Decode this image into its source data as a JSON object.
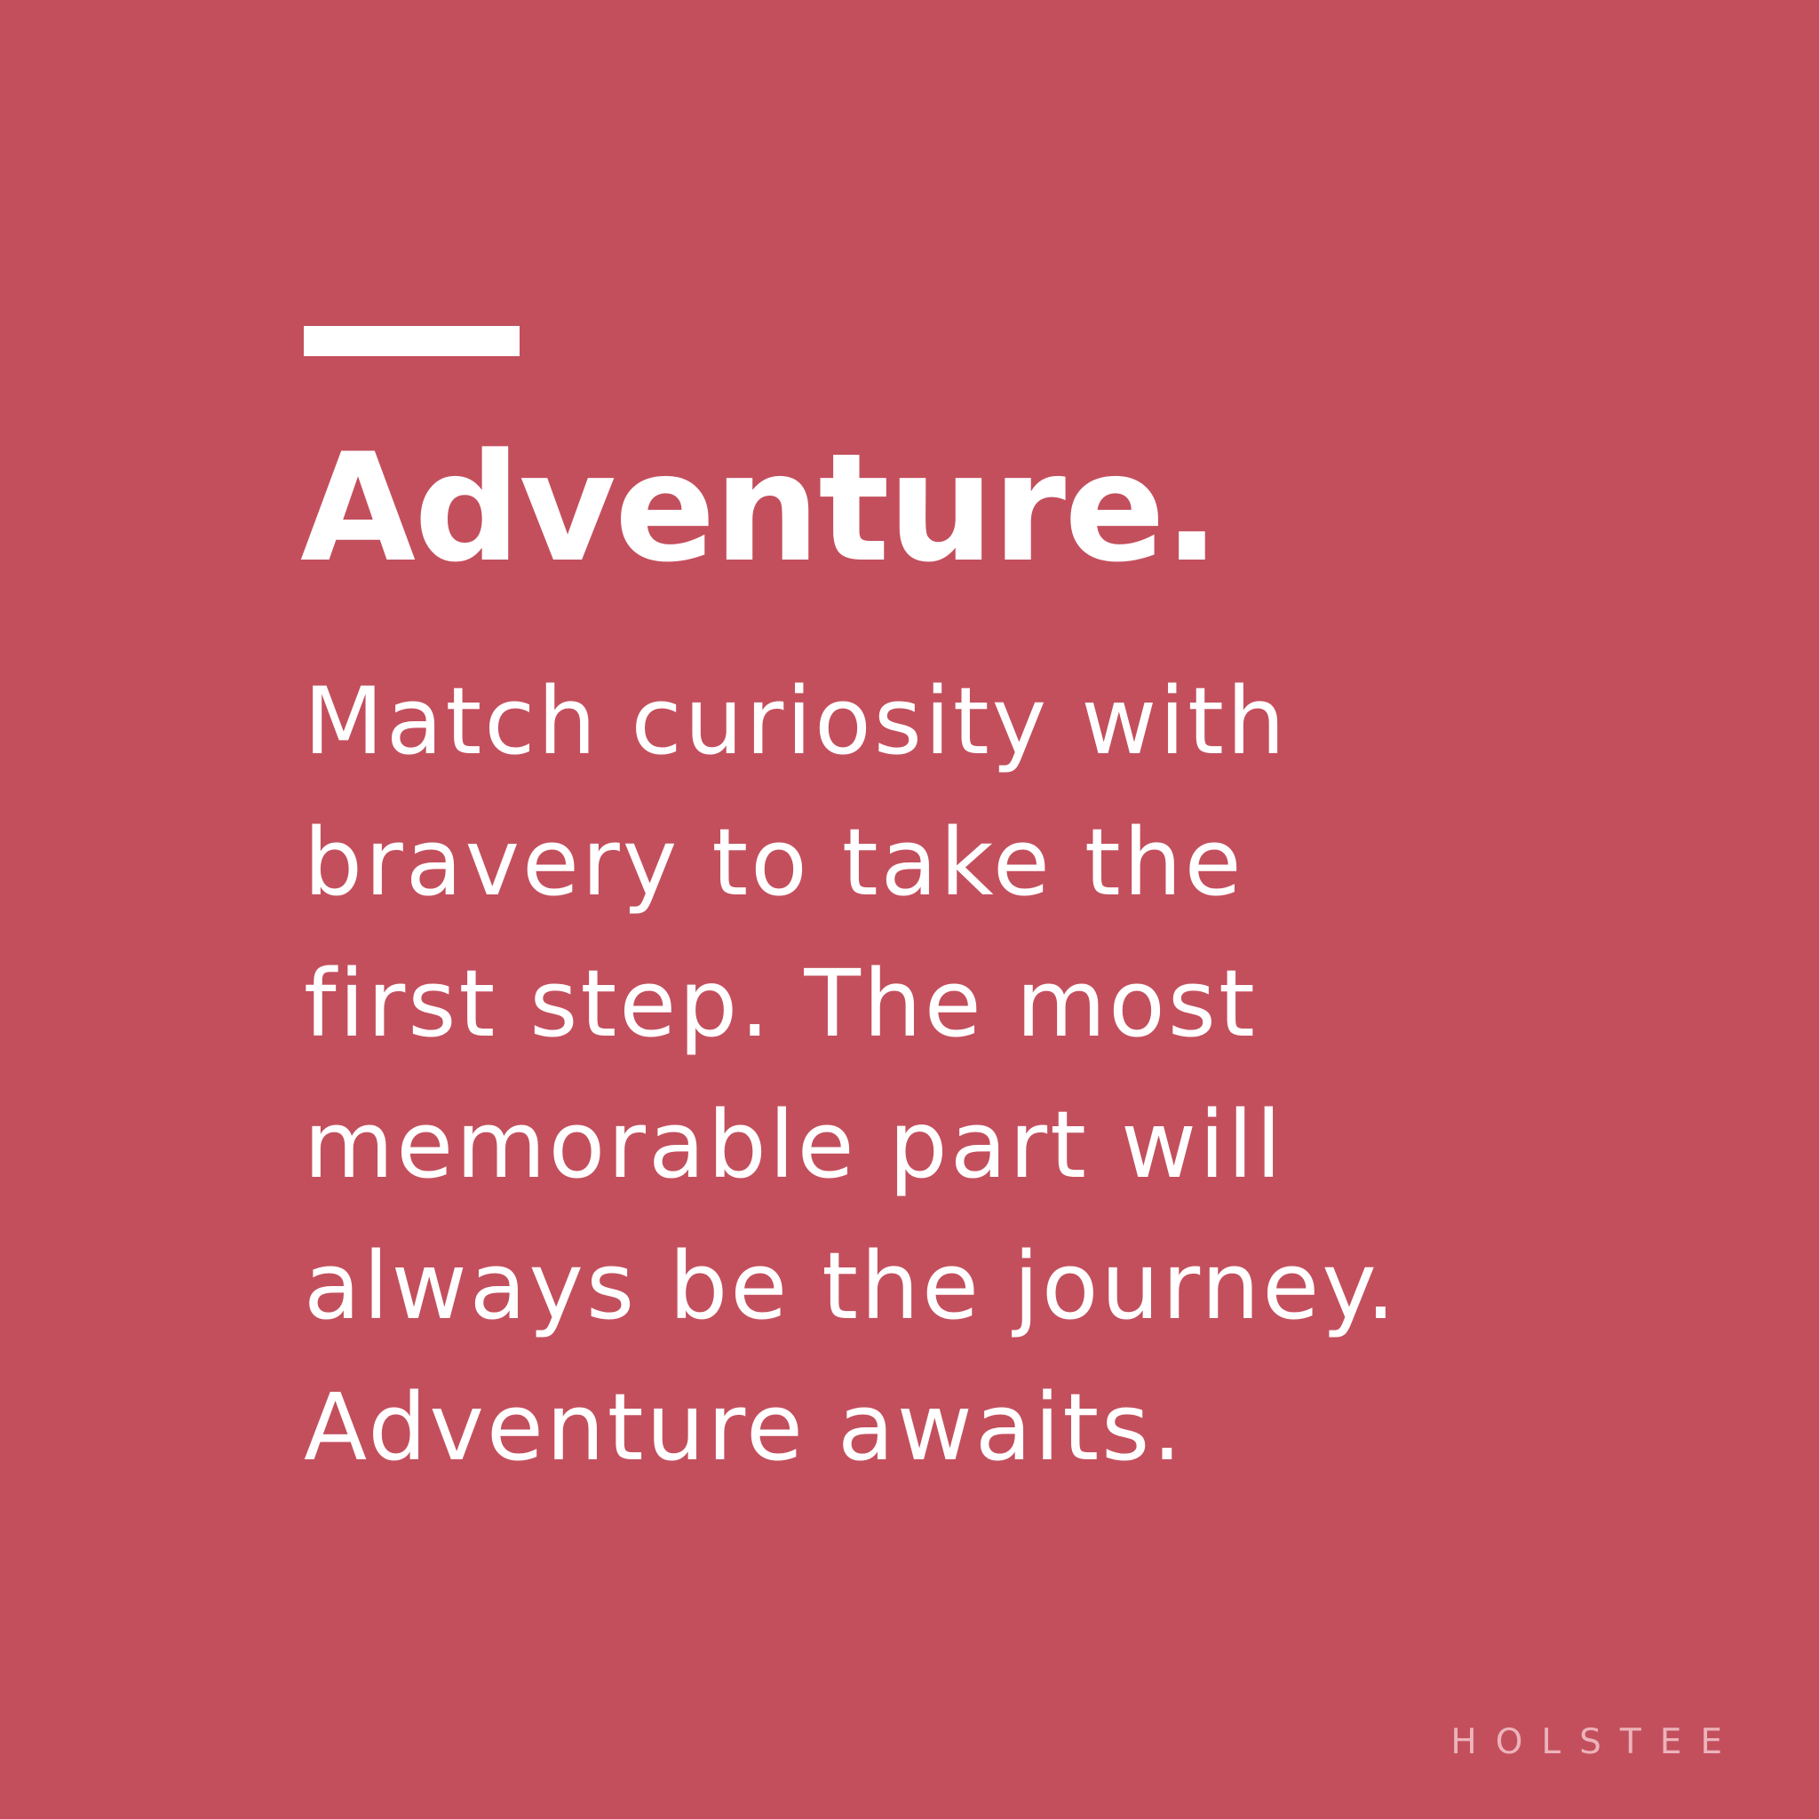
{
  "background_color": "#c34f5d",
  "title": "Adventure.",
  "body_lines": [
    "Match curiosity with",
    "bravery to take the",
    "first step. The most",
    "memorable part will",
    "always be the journey.",
    "Adventure awaits."
  ],
  "brand": "HOLSTEE"
}
